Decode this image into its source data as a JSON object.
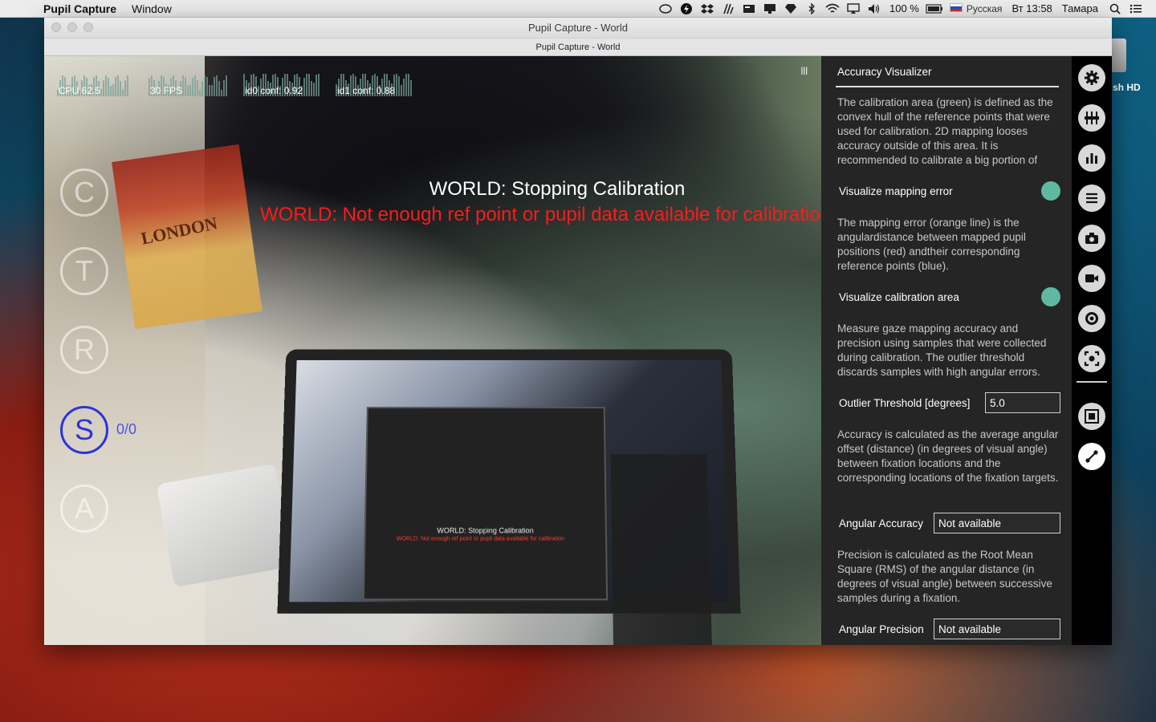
{
  "menubar": {
    "app_name": "Pupil Capture",
    "menus": [
      "Window"
    ],
    "battery": "100 %",
    "language": "Русская",
    "clock": "Вт 13:58",
    "user": "Тамара"
  },
  "desktop": {
    "disk_label": "sh HD"
  },
  "window": {
    "title": "Pupil Capture - World",
    "subtitle": "Pupil Capture - World"
  },
  "graphs": [
    {
      "label": "CPU 62.5"
    },
    {
      "label": "30 FPS"
    },
    {
      "label": "id0 conf: 0.92"
    },
    {
      "label": "id1 conf: 0.88"
    }
  ],
  "calibration_buttons": [
    {
      "letter": "C",
      "name": "calibrate-button"
    },
    {
      "letter": "T",
      "name": "test-button"
    },
    {
      "letter": "R",
      "name": "record-button"
    },
    {
      "letter": "S",
      "name": "stream-button"
    },
    {
      "letter": "A",
      "name": "annotate-button"
    }
  ],
  "counter": "0/0",
  "world": {
    "menu_handle": "III",
    "message_primary": "WORLD: Stopping Calibration",
    "message_error": "WORLD: Not enough ref point or pupil data available for calibration.",
    "poster_text": "LONDON",
    "laptop_text1": "WORLD: Stopping Calibration",
    "laptop_text2": "WORLD: Not enough ref point or pupil data available for calibration"
  },
  "panel": {
    "title": "Accuracy Visualizer",
    "desc1": "The calibration area (green) is defined as the convex hull of the reference points that were used for calibration. 2D mapping looses accuracy outside of this area. It is recommended to calibrate a big portion of",
    "toggle1_label": "Visualize mapping error",
    "desc2": "The mapping error (orange line) is the angulardistance between mapped pupil positions (red) andtheir corresponding reference points (blue).",
    "toggle2_label": "Visualize calibration area",
    "desc3": "Measure gaze mapping accuracy and precision using samples that were collected during calibration. The outlier threshold discards samples with high angular errors.",
    "outlier_label": "Outlier Threshold [degrees]",
    "outlier_value": "5.0",
    "desc4": "Accuracy is calculated as the average angular offset (distance) (in degrees of visual angle) between fixation locations and the corresponding locations of the fixation targets.",
    "accuracy_label": "Angular Accuracy",
    "accuracy_value": "Not available",
    "desc5": "Precision is calculated as the Root Mean Square (RMS) of the angular distance (in degrees of visual angle) between successive samples during a fixation.",
    "precision_label": "Angular Precision",
    "precision_value": "Not available"
  },
  "colors": {
    "toggle_on": "#5fb8a2",
    "error_text": "#ff1a1a",
    "active_calib": "#2a35d8"
  },
  "iconbar": [
    "gear-icon",
    "sliders-icon",
    "bar-chart-icon",
    "list-icon",
    "camera-icon",
    "video-icon",
    "target-icon",
    "capture-focus-icon",
    "frame-icon",
    "accuracy-icon"
  ]
}
